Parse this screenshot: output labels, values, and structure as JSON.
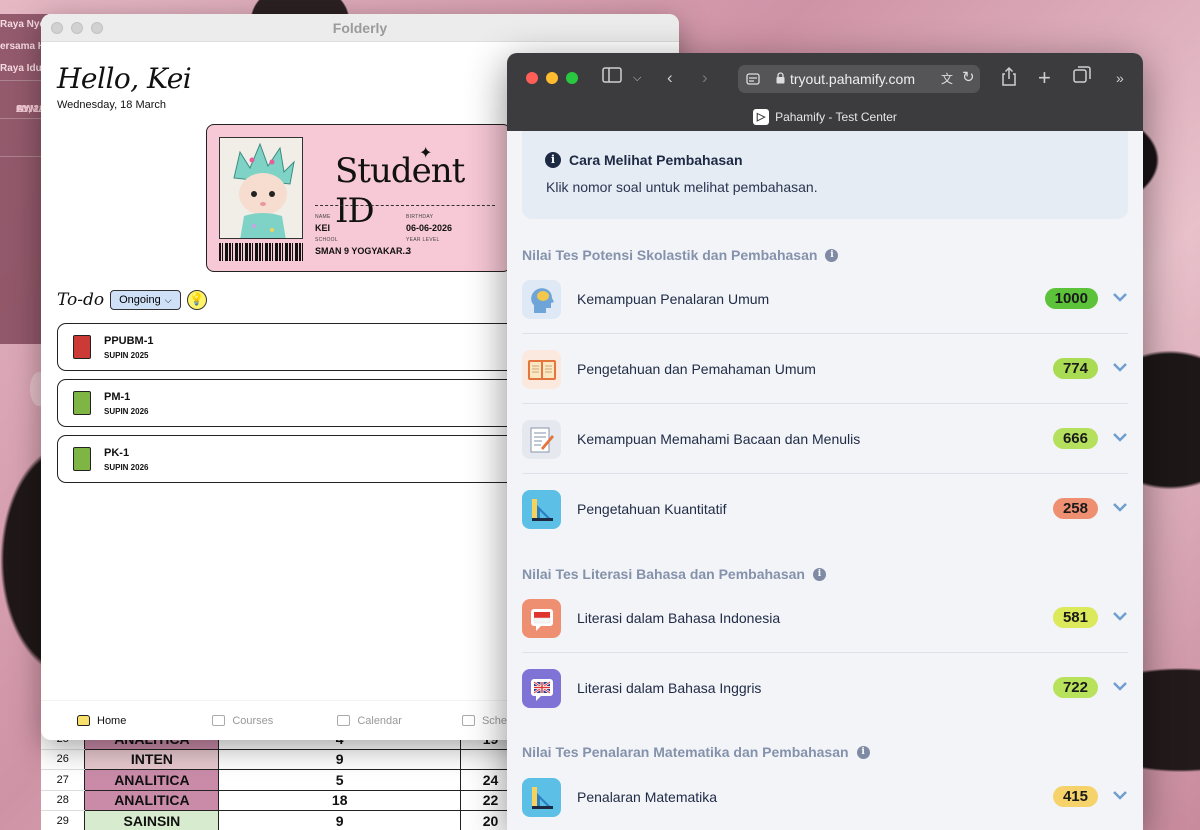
{
  "desktop": {
    "calendar_events": [
      "OW",
      "Raya Nyep",
      "20 MAR",
      "ersama Ha",
      "AY, 21 MA",
      "Raya Idul"
    ]
  },
  "spreadsheet": {
    "rows": [
      {
        "num": "25",
        "category": "ANALITICA",
        "value": "4",
        "value2": "19",
        "color": "#c98ba8"
      },
      {
        "num": "26",
        "category": "INTEN",
        "value": "9",
        "value2": "",
        "color": "#e7c9ce"
      },
      {
        "num": "27",
        "category": "ANALITICA",
        "value": "5",
        "value2": "24",
        "color": "#c98ba8"
      },
      {
        "num": "28",
        "category": "ANALITICA",
        "value": "18",
        "value2": "22",
        "color": "#c98ba8"
      },
      {
        "num": "29",
        "category": "SAINSIN",
        "value": "9",
        "value2": "20",
        "color": "#d7eccf"
      }
    ]
  },
  "folderly": {
    "window_title": "Folderly",
    "greeting": "Hello, Kei",
    "date": "Wednesday, 18 March",
    "id_card": {
      "title": "Student ID",
      "name_label": "NAME",
      "name": "KEI",
      "birthday_label": "BIRTHDAY",
      "birthday": "06-06-2026",
      "school_label": "SCHOOL",
      "school": "SMAN 9 YOGYAKAR...",
      "year_label": "YEAR LEVEL",
      "year": "3"
    },
    "todo": {
      "title": "To-do",
      "filter": "Ongoing",
      "items": [
        {
          "title": "PPUBM-1",
          "subtitle": "SUPIN 2025",
          "icon": "book-red-icon"
        },
        {
          "title": "PM-1",
          "subtitle": "SUPIN 2026",
          "icon": "book-green-icon"
        },
        {
          "title": "PK-1",
          "subtitle": "SUPIN 2026",
          "icon": "book-green-icon"
        }
      ]
    },
    "nav": {
      "home": "Home",
      "courses": "Courses",
      "calendar": "Calendar",
      "schedule": "Sched"
    }
  },
  "safari": {
    "url": "tryout.pahamify.com",
    "tab_title": "Pahamify - Test Center",
    "info": {
      "title": "Cara Melihat Pembahasan",
      "text": "Klik nomor soal untuk melihat pembahasan."
    },
    "sections": [
      {
        "title": "Nilai Tes Potensi Skolastik dan Pembahasan",
        "items": [
          {
            "label": "Kemampuan Penalaran Umum",
            "score": "1000",
            "color": "#5bc23a",
            "icon": "brain-head-icon"
          },
          {
            "label": "Pengetahuan dan Pemahaman Umum",
            "score": "774",
            "color": "#a9dc52",
            "icon": "open-book-icon"
          },
          {
            "label": "Kemampuan Memahami Bacaan dan Menulis",
            "score": "666",
            "color": "#b5e05e",
            "icon": "writing-document-icon"
          },
          {
            "label": "Pengetahuan Kuantitatif",
            "score": "258",
            "color": "#ef8f72",
            "icon": "ruler-triangle-icon"
          }
        ]
      },
      {
        "title": "Nilai Tes Literasi Bahasa dan Pembahasan",
        "items": [
          {
            "label": "Literasi dalam Bahasa Indonesia",
            "score": "581",
            "color": "#dce95a",
            "icon": "indonesia-flag-bubble-icon"
          },
          {
            "label": "Literasi dalam Bahasa Inggris",
            "score": "722",
            "color": "#b9e25c",
            "icon": "uk-flag-bubble-icon"
          }
        ]
      },
      {
        "title": "Nilai Tes Penalaran Matematika dan Pembahasan",
        "items": [
          {
            "label": "Penalaran Matematika",
            "score": "415",
            "color": "#f6d36a",
            "icon": "ruler-triangle-icon"
          }
        ]
      }
    ]
  }
}
